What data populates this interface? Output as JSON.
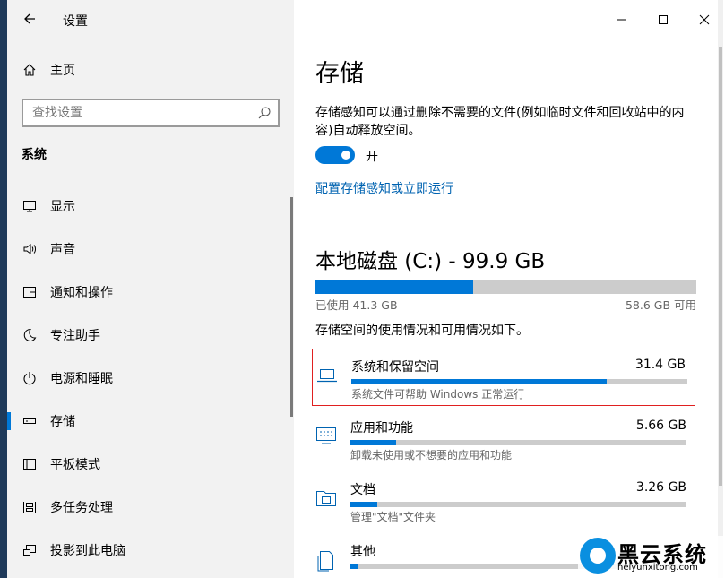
{
  "window": {
    "title": "设置",
    "controls": {
      "minimize": "minimize-icon",
      "maximize": "maximize-icon",
      "close": "close-icon"
    }
  },
  "sidebar": {
    "home_label": "主页",
    "search_placeholder": "查找设置",
    "section_label": "系统",
    "items": [
      {
        "label": "显示",
        "icon": "display-icon"
      },
      {
        "label": "声音",
        "icon": "speaker-icon"
      },
      {
        "label": "通知和操作",
        "icon": "notification-icon"
      },
      {
        "label": "专注助手",
        "icon": "moon-icon"
      },
      {
        "label": "电源和睡眠",
        "icon": "power-icon"
      },
      {
        "label": "存储",
        "icon": "storage-icon",
        "selected": true
      },
      {
        "label": "平板模式",
        "icon": "tablet-icon"
      },
      {
        "label": "多任务处理",
        "icon": "multitask-icon"
      },
      {
        "label": "投影到此电脑",
        "icon": "project-icon"
      }
    ]
  },
  "main": {
    "title": "存储",
    "storage_sense_desc": "存储感知可以通过删除不需要的文件(例如临时文件和回收站中的内容)自动释放空间。",
    "toggle_state": "开",
    "toggle_on": true,
    "configure_link": "配置存储感知或立即运行",
    "disk": {
      "title": "本地磁盘 (C:) - 99.9 GB",
      "used_label": "已使用 41.3 GB",
      "free_label": "58.6 GB 可用",
      "used_fraction": 0.413
    },
    "usage_desc": "存储空间的使用情况和可用情况如下。",
    "categories": [
      {
        "name": "系统和保留空间",
        "size": "31.4 GB",
        "desc": "系统文件可帮助 Windows 正常运行",
        "fraction": 0.76,
        "icon": "laptop-icon"
      },
      {
        "name": "应用和功能",
        "size": "5.66 GB",
        "desc": "卸载未使用或不想要的应用和功能",
        "fraction": 0.135,
        "icon": "apps-icon"
      },
      {
        "name": "文档",
        "size": "3.26 GB",
        "desc": "管理\"文档\"文件夹",
        "fraction": 0.08,
        "icon": "folder-icon"
      },
      {
        "name": "其他",
        "size": "",
        "desc": "",
        "fraction": 0.02,
        "icon": "other-icon"
      }
    ]
  },
  "watermark": {
    "title": "黑云系统",
    "url": "heiyunxitong.com"
  },
  "colors": {
    "accent": "#0078d7",
    "link": "#0063b1",
    "highlight_border": "#e02020"
  }
}
